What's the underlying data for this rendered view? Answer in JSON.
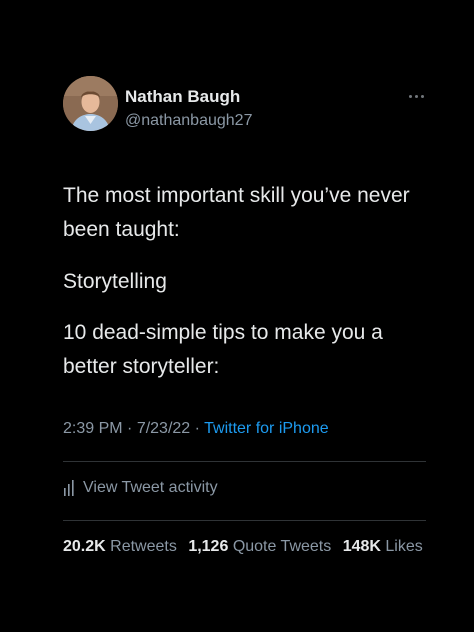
{
  "author": {
    "name": "Nathan Baugh",
    "handle": "@nathanbaugh27"
  },
  "tweet": {
    "lines": [
      "The most important skill you’ve never",
      "been taught:",
      "Storytelling",
      "10 dead-simple tips to make you a",
      "better storyteller:"
    ]
  },
  "meta": {
    "time": "2:39 PM",
    "separator1": " · ",
    "date": "7/23/22",
    "separator2": " · ",
    "source": "Twitter for iPhone"
  },
  "activity": {
    "label": "View Tweet activity",
    "icon": "analytics-icon"
  },
  "stats": {
    "retweets_count": "20.2K",
    "retweets_label": "Retweets",
    "quotes_count": "1,126",
    "quotes_label": "Quote Tweets",
    "likes_count": "148K",
    "likes_label": "Likes"
  },
  "colors": {
    "background": "#000000",
    "text": "#e7e9ea",
    "secondary": "#8b98a5",
    "link": "#1d9bf0",
    "divider": "#2f3336"
  }
}
